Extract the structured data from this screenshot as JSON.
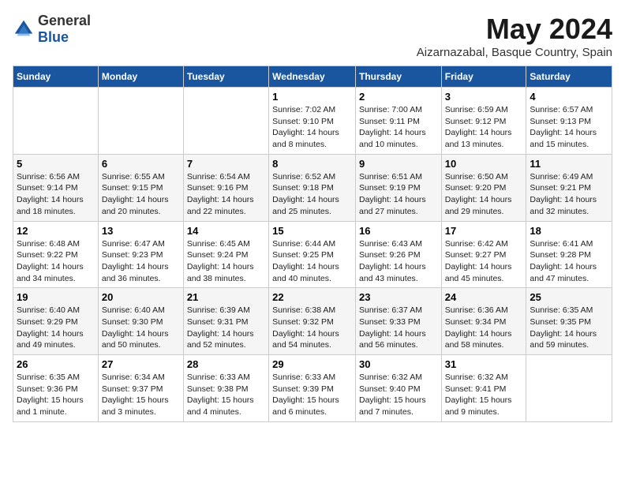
{
  "header": {
    "logo_general": "General",
    "logo_blue": "Blue",
    "title": "May 2024",
    "subtitle": "Aizarnazabal, Basque Country, Spain"
  },
  "days_of_week": [
    "Sunday",
    "Monday",
    "Tuesday",
    "Wednesday",
    "Thursday",
    "Friday",
    "Saturday"
  ],
  "weeks": [
    [
      {
        "day": "",
        "info": ""
      },
      {
        "day": "",
        "info": ""
      },
      {
        "day": "",
        "info": ""
      },
      {
        "day": "1",
        "info": "Sunrise: 7:02 AM\nSunset: 9:10 PM\nDaylight: 14 hours\nand 8 minutes."
      },
      {
        "day": "2",
        "info": "Sunrise: 7:00 AM\nSunset: 9:11 PM\nDaylight: 14 hours\nand 10 minutes."
      },
      {
        "day": "3",
        "info": "Sunrise: 6:59 AM\nSunset: 9:12 PM\nDaylight: 14 hours\nand 13 minutes."
      },
      {
        "day": "4",
        "info": "Sunrise: 6:57 AM\nSunset: 9:13 PM\nDaylight: 14 hours\nand 15 minutes."
      }
    ],
    [
      {
        "day": "5",
        "info": "Sunrise: 6:56 AM\nSunset: 9:14 PM\nDaylight: 14 hours\nand 18 minutes."
      },
      {
        "day": "6",
        "info": "Sunrise: 6:55 AM\nSunset: 9:15 PM\nDaylight: 14 hours\nand 20 minutes."
      },
      {
        "day": "7",
        "info": "Sunrise: 6:54 AM\nSunset: 9:16 PM\nDaylight: 14 hours\nand 22 minutes."
      },
      {
        "day": "8",
        "info": "Sunrise: 6:52 AM\nSunset: 9:18 PM\nDaylight: 14 hours\nand 25 minutes."
      },
      {
        "day": "9",
        "info": "Sunrise: 6:51 AM\nSunset: 9:19 PM\nDaylight: 14 hours\nand 27 minutes."
      },
      {
        "day": "10",
        "info": "Sunrise: 6:50 AM\nSunset: 9:20 PM\nDaylight: 14 hours\nand 29 minutes."
      },
      {
        "day": "11",
        "info": "Sunrise: 6:49 AM\nSunset: 9:21 PM\nDaylight: 14 hours\nand 32 minutes."
      }
    ],
    [
      {
        "day": "12",
        "info": "Sunrise: 6:48 AM\nSunset: 9:22 PM\nDaylight: 14 hours\nand 34 minutes."
      },
      {
        "day": "13",
        "info": "Sunrise: 6:47 AM\nSunset: 9:23 PM\nDaylight: 14 hours\nand 36 minutes."
      },
      {
        "day": "14",
        "info": "Sunrise: 6:45 AM\nSunset: 9:24 PM\nDaylight: 14 hours\nand 38 minutes."
      },
      {
        "day": "15",
        "info": "Sunrise: 6:44 AM\nSunset: 9:25 PM\nDaylight: 14 hours\nand 40 minutes."
      },
      {
        "day": "16",
        "info": "Sunrise: 6:43 AM\nSunset: 9:26 PM\nDaylight: 14 hours\nand 43 minutes."
      },
      {
        "day": "17",
        "info": "Sunrise: 6:42 AM\nSunset: 9:27 PM\nDaylight: 14 hours\nand 45 minutes."
      },
      {
        "day": "18",
        "info": "Sunrise: 6:41 AM\nSunset: 9:28 PM\nDaylight: 14 hours\nand 47 minutes."
      }
    ],
    [
      {
        "day": "19",
        "info": "Sunrise: 6:40 AM\nSunset: 9:29 PM\nDaylight: 14 hours\nand 49 minutes."
      },
      {
        "day": "20",
        "info": "Sunrise: 6:40 AM\nSunset: 9:30 PM\nDaylight: 14 hours\nand 50 minutes."
      },
      {
        "day": "21",
        "info": "Sunrise: 6:39 AM\nSunset: 9:31 PM\nDaylight: 14 hours\nand 52 minutes."
      },
      {
        "day": "22",
        "info": "Sunrise: 6:38 AM\nSunset: 9:32 PM\nDaylight: 14 hours\nand 54 minutes."
      },
      {
        "day": "23",
        "info": "Sunrise: 6:37 AM\nSunset: 9:33 PM\nDaylight: 14 hours\nand 56 minutes."
      },
      {
        "day": "24",
        "info": "Sunrise: 6:36 AM\nSunset: 9:34 PM\nDaylight: 14 hours\nand 58 minutes."
      },
      {
        "day": "25",
        "info": "Sunrise: 6:35 AM\nSunset: 9:35 PM\nDaylight: 14 hours\nand 59 minutes."
      }
    ],
    [
      {
        "day": "26",
        "info": "Sunrise: 6:35 AM\nSunset: 9:36 PM\nDaylight: 15 hours\nand 1 minute."
      },
      {
        "day": "27",
        "info": "Sunrise: 6:34 AM\nSunset: 9:37 PM\nDaylight: 15 hours\nand 3 minutes."
      },
      {
        "day": "28",
        "info": "Sunrise: 6:33 AM\nSunset: 9:38 PM\nDaylight: 15 hours\nand 4 minutes."
      },
      {
        "day": "29",
        "info": "Sunrise: 6:33 AM\nSunset: 9:39 PM\nDaylight: 15 hours\nand 6 minutes."
      },
      {
        "day": "30",
        "info": "Sunrise: 6:32 AM\nSunset: 9:40 PM\nDaylight: 15 hours\nand 7 minutes."
      },
      {
        "day": "31",
        "info": "Sunrise: 6:32 AM\nSunset: 9:41 PM\nDaylight: 15 hours\nand 9 minutes."
      },
      {
        "day": "",
        "info": ""
      }
    ]
  ]
}
